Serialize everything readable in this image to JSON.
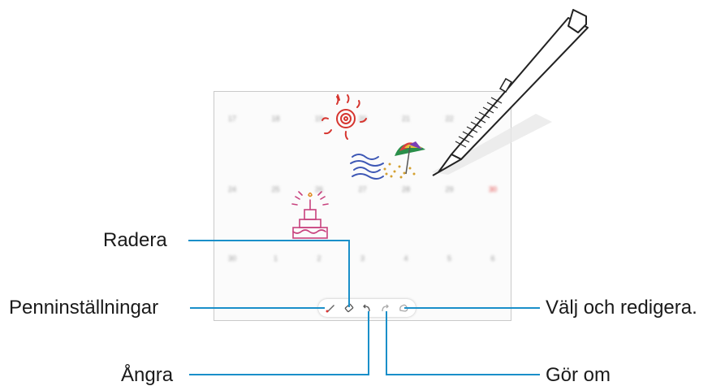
{
  "callouts": {
    "radera": "Radera",
    "penninstallningar": "Penninställningar",
    "angra": "Ångra",
    "valj_och_redigera": "Välj och redigera.",
    "gor_om": "Gör om"
  },
  "calendar": {
    "row1": [
      "17",
      "18",
      "19",
      "20",
      "21",
      "22",
      "23"
    ],
    "row2": [
      "24",
      "25",
      "26",
      "27",
      "28",
      "29",
      "30"
    ],
    "row3": [
      "30",
      "1",
      "2",
      "3",
      "4",
      "5",
      "6"
    ]
  },
  "toolbar_icons": [
    "pen-settings-icon",
    "eraser-icon",
    "undo-icon",
    "redo-icon",
    "selection-icon"
  ],
  "colors": {
    "callout_line": "#1a8fc9",
    "red_date": "#e03a3a"
  }
}
